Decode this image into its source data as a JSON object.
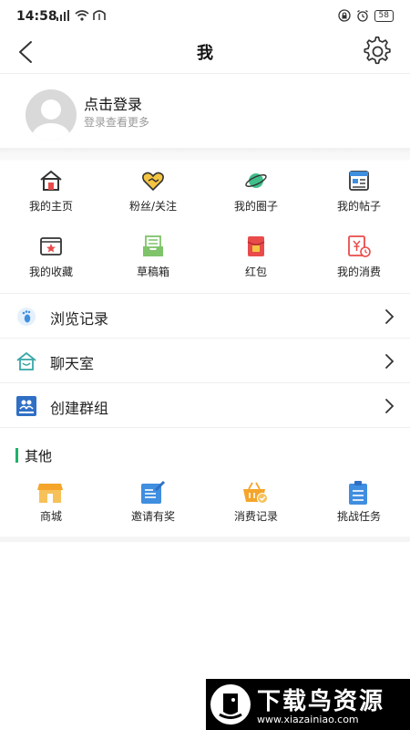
{
  "status_bar": {
    "time": "14:58",
    "battery": "58"
  },
  "header": {
    "title": "我"
  },
  "login": {
    "title": "点击登录",
    "subtitle": "登录查看更多"
  },
  "grid": [
    {
      "label": "我的主页",
      "icon": "home-icon"
    },
    {
      "label": "粉丝/关注",
      "icon": "heart-handshake-icon"
    },
    {
      "label": "我的圈子",
      "icon": "planet-icon"
    },
    {
      "label": "我的帖子",
      "icon": "post-card-icon"
    },
    {
      "label": "我的收藏",
      "icon": "star-window-icon"
    },
    {
      "label": "草稿箱",
      "icon": "inbox-tray-icon"
    },
    {
      "label": "红包",
      "icon": "red-envelope-icon"
    },
    {
      "label": "我的消费",
      "icon": "receipt-yuan-icon"
    }
  ],
  "list": [
    {
      "label": "浏览记录",
      "icon": "footprint-icon"
    },
    {
      "label": "聊天室",
      "icon": "chat-house-icon"
    },
    {
      "label": "创建群组",
      "icon": "create-group-icon"
    }
  ],
  "other": {
    "heading": "其他",
    "items": [
      {
        "label": "商城",
        "icon": "shop-icon"
      },
      {
        "label": "邀请有奖",
        "icon": "invite-pen-icon"
      },
      {
        "label": "消费记录",
        "icon": "basket-check-icon"
      },
      {
        "label": "挑战任务",
        "icon": "clipboard-task-icon"
      }
    ]
  },
  "watermark": {
    "brand": "下载鸟资源",
    "url": "www.xiazainiao.com"
  },
  "colors": {
    "accent": "#1fb06a",
    "blue": "#3f8ee0",
    "red": "#e94b4b",
    "orange": "#f4a52a"
  }
}
